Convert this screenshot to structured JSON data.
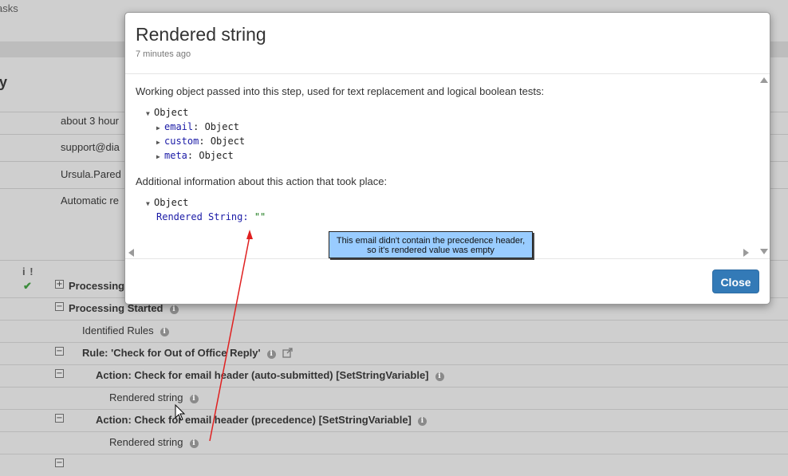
{
  "background": {
    "tabs_fragment": "asks",
    "heading_fragment": "y",
    "cells": [
      "about 3 hour",
      "support@dia",
      "Ursula.Pared",
      "Automatic re"
    ],
    "status_icons": "i !",
    "tree": [
      {
        "label": "Processing",
        "toggle": "+",
        "bold": true
      },
      {
        "label": "Processing Started",
        "toggle": "−",
        "bold": true
      },
      {
        "label": "Identified Rules",
        "toggle": "",
        "bold": false
      },
      {
        "label": "Rule: 'Check for Out of Office Reply'",
        "toggle": "−",
        "bold": true
      },
      {
        "label": "Action: Check for email header (auto-submitted) [SetStringVariable]",
        "toggle": "−",
        "bold": true
      },
      {
        "label": "Rendered string",
        "toggle": "",
        "bold": false
      },
      {
        "label": "Action: Check for email header (precedence) [SetStringVariable]",
        "toggle": "−",
        "bold": true
      },
      {
        "label": "Rendered string",
        "toggle": "",
        "bold": false
      }
    ]
  },
  "modal": {
    "title": "Rendered string",
    "subtitle": "7 minutes ago",
    "intro": "Working object passed into this step, used for text replacement and logical boolean tests:",
    "working_object": {
      "root": "Object",
      "props": [
        {
          "key": "email",
          "value": "Object"
        },
        {
          "key": "custom",
          "value": "Object"
        },
        {
          "key": "meta",
          "value": "Object"
        }
      ]
    },
    "additional_label": "Additional information about this action that took place:",
    "additional_object": {
      "root": "Object",
      "key": "Rendered String:",
      "value": "\"\""
    },
    "close_label": "Close"
  },
  "annotation": {
    "line1": "This email didn't contain the precedence header,",
    "line2": "so it's rendered value was empty"
  },
  "colors": {
    "primary_button": "#337ab7",
    "annotation_bg": "#99ccff",
    "arrow": "#e02020",
    "check": "#3c8c3c"
  }
}
